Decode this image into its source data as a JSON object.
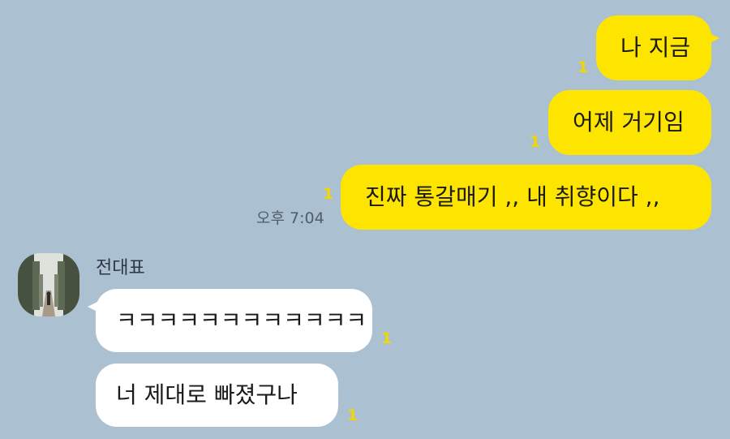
{
  "chat": {
    "outgoing": [
      {
        "text": "나 지금",
        "unread": "1"
      },
      {
        "text": "어제 거기임",
        "unread": "1"
      },
      {
        "text": "진짜 통갈매기 ,, 내 취향이다 ,,",
        "unread": "1",
        "time": "오후 7:04"
      }
    ],
    "sender": {
      "name": "전대표",
      "avatar_icon": "profile-photo-forest-path"
    },
    "incoming": [
      {
        "text": "ㅋㅋㅋㅋㅋㅋㅋㅋㅋㅋㅋㅋ",
        "unread": "1"
      },
      {
        "text": "너 제대로 빠졌구나",
        "unread": "1"
      }
    ]
  },
  "colors": {
    "background": "#abc1d1",
    "outgoing_bubble": "#fee500",
    "incoming_bubble": "#ffffff",
    "unread_count": "#f2d600"
  }
}
